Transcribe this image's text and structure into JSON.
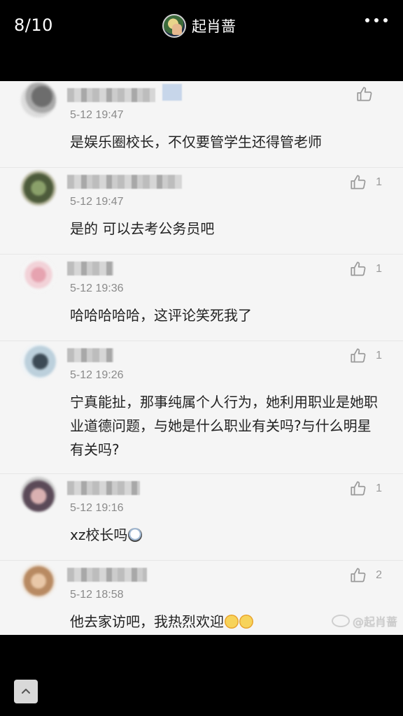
{
  "viewer": {
    "counter": "8/10",
    "author_name": "起肖蔷",
    "more_icon": "more-dots-icon"
  },
  "comments": [
    {
      "time": "5-12 19:47",
      "text": "是娱乐圈校长，不仅要管学生还得管老师",
      "likes": ""
    },
    {
      "time": "5-12 19:47",
      "text": "是的 可以去考公务员吧",
      "likes": "1"
    },
    {
      "time": "5-12 19:36",
      "text": "哈哈哈哈哈，这评论笑死我了",
      "likes": "1"
    },
    {
      "time": "5-12 19:26",
      "text": "宁真能扯，那事纯属个人行为，她利用职业是她职业道德问题，与她是什么职业有关吗?与什么明星有关吗?",
      "likes": "1"
    },
    {
      "time": "5-12 19:16",
      "text": "xz校长吗",
      "likes": "1"
    },
    {
      "time": "5-12 18:58",
      "text": "他去家访吧，我热烈欢迎",
      "likes": "2"
    }
  ],
  "watermark": "@起肖蔷",
  "colors": {
    "background": "#000000",
    "card": "#f5f5f5",
    "text": "#222222",
    "meta": "#8a8a8a"
  }
}
